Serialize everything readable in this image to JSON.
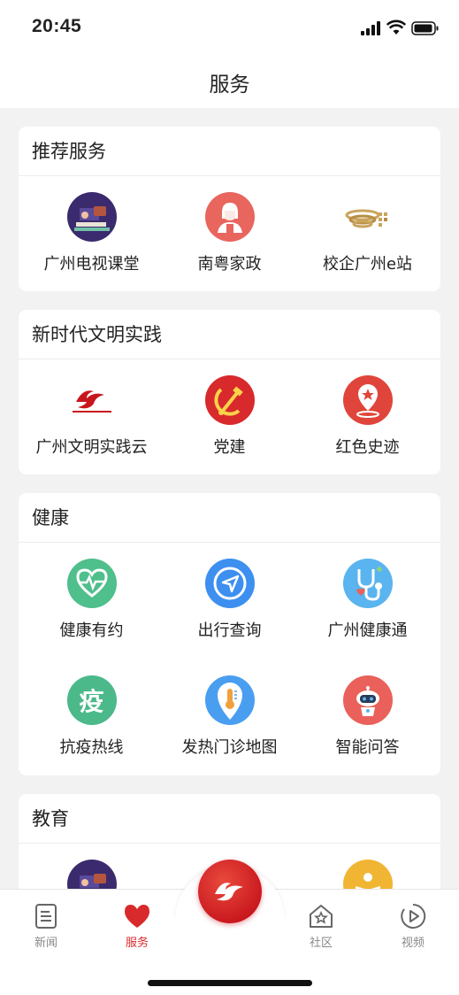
{
  "status_bar": {
    "time": "20:45"
  },
  "header": {
    "title": "服务"
  },
  "sections": [
    {
      "title": "推荐服务",
      "items": [
        {
          "label": "广州电视课堂",
          "icon": "tv-classroom-icon",
          "color": "#3b2a6e"
        },
        {
          "label": "南粤家政",
          "icon": "housekeeping-worker-icon",
          "color": "#e8665e"
        },
        {
          "label": "校企广州e站",
          "icon": "campus-enterprise-logo-icon",
          "color": "#c9a45c"
        }
      ]
    },
    {
      "title": "新时代文明实践",
      "items": [
        {
          "label": "广州文明实践云",
          "icon": "civilization-practice-logo-icon",
          "color": "#c8161d"
        },
        {
          "label": "党建",
          "icon": "hammer-sickle-icon",
          "color": "#d8292c"
        },
        {
          "label": "红色史迹",
          "icon": "red-star-location-icon",
          "color": "#e0453b"
        }
      ]
    },
    {
      "title": "健康",
      "items": [
        {
          "label": "健康有约",
          "icon": "heart-pulse-icon",
          "color": "#4fbf8c"
        },
        {
          "label": "出行查询",
          "icon": "navigation-arrow-icon",
          "color": "#3d8ff0"
        },
        {
          "label": "广州健康通",
          "icon": "stethoscope-icon",
          "color": "#5ab4ef"
        },
        {
          "label": "抗疫热线",
          "icon": "epidemic-hotline-icon",
          "color": "#4bb98a",
          "glyph": "疫"
        },
        {
          "label": "发热门诊地图",
          "icon": "thermometer-map-icon",
          "color": "#4a9ef0"
        },
        {
          "label": "智能问答",
          "icon": "robot-icon",
          "color": "#e9615a"
        }
      ]
    },
    {
      "title": "教育",
      "items": [
        {
          "label": "",
          "icon": "tv-classroom-icon",
          "color": "#3b2a6e"
        },
        {
          "label": "",
          "icon": "book-reading-icon",
          "color": "#f0b532"
        }
      ]
    }
  ],
  "tab_bar": {
    "tabs": [
      {
        "label": "新闻",
        "icon": "news-document-icon"
      },
      {
        "label": "服务",
        "icon": "heart-icon",
        "active": true
      },
      {
        "label": "社区",
        "icon": "community-house-star-icon"
      },
      {
        "label": "视频",
        "icon": "play-circle-icon"
      }
    ],
    "center_icon": "brand-logo-icon"
  },
  "colors": {
    "accent": "#d8292c",
    "background": "#f2f2f2"
  }
}
